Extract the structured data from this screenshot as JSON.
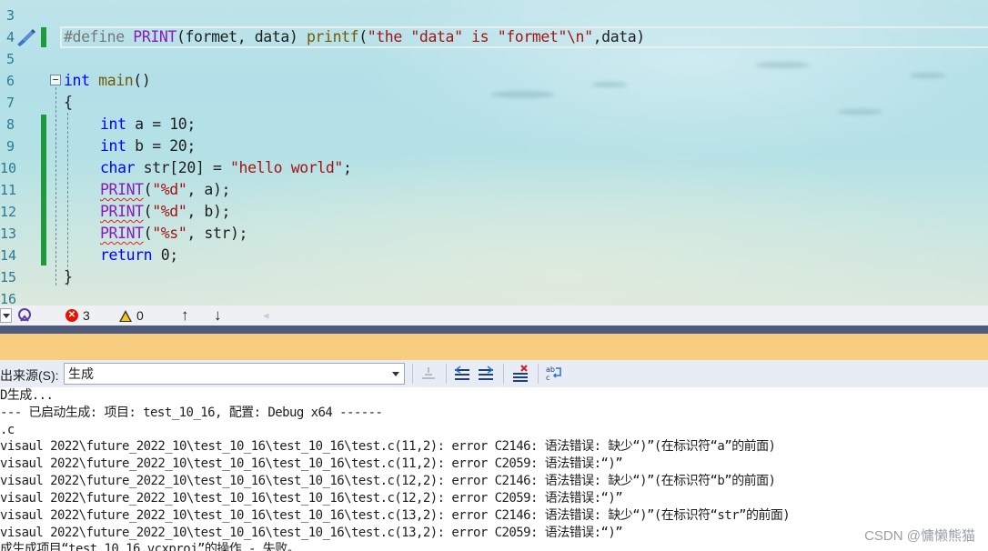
{
  "editor": {
    "line_numbers": [
      "3",
      "4",
      "5",
      "6",
      "7",
      "8",
      "9",
      "10",
      "11",
      "12",
      "13",
      "14",
      "15",
      "16"
    ],
    "code": {
      "l4": {
        "directive": "#define",
        "macro": "PRINT",
        "params": "(formet, data) ",
        "fn": "printf",
        "open": "(",
        "str": "\"the \"data\" is \"formet\"\\n\"",
        "rest": ",data)"
      },
      "l6": {
        "kw": "int",
        "sp": " ",
        "fn": "main",
        "rest": "()"
      },
      "l7": "{",
      "l8": {
        "kw": "int",
        "rest": " a = 10;"
      },
      "l9": {
        "kw": "int",
        "rest": " b = 20;"
      },
      "l10": {
        "kw": "char",
        "mid": " str[20] = ",
        "str": "\"hello world\"",
        "end": ";"
      },
      "l11": {
        "macro": "PRINT",
        "open": "(",
        "str": "\"%d\"",
        "rest": ", a);"
      },
      "l12": {
        "macro": "PRINT",
        "open": "(",
        "str": "\"%d\"",
        "rest": ", b);"
      },
      "l13": {
        "macro": "PRINT",
        "open": "(",
        "str": "\"%s\"",
        "rest": ", str);"
      },
      "l14": {
        "kw": "return",
        "rest": " 0;"
      },
      "l15": "}"
    }
  },
  "status": {
    "error_count": "3",
    "warning_count": "0",
    "up_arrow": "↑",
    "down_arrow": "↓",
    "left_arrow": "◂"
  },
  "output": {
    "source_label": "出来源(S):",
    "source_value": "生成",
    "lines": [
      "D生成...",
      "--- 已启动生成: 项目: test_10_16, 配置: Debug x64 ------",
      ".c",
      "visaul 2022\\future_2022_10\\test_10_16\\test_10_16\\test.c(11,2): error C2146: 语法错误: 缺少“)”(在标识符“a”的前面)",
      "visaul 2022\\future_2022_10\\test_10_16\\test_10_16\\test.c(11,2): error C2059: 语法错误:“)”",
      "visaul 2022\\future_2022_10\\test_10_16\\test_10_16\\test.c(12,2): error C2146: 语法错误: 缺少“)”(在标识符“b”的前面)",
      "visaul 2022\\future_2022_10\\test_10_16\\test_10_16\\test.c(12,2): error C2059: 语法错误:“)”",
      "visaul 2022\\future_2022_10\\test_10_16\\test_10_16\\test.c(13,2): error C2146: 语法错误: 缺少“)”(在标识符“str”的前面)",
      "visaul 2022\\future_2022_10\\test_10_16\\test_10_16\\test.c(13,2): error C2059: 语法错误:“)”",
      "成生成项目“test_10_16.vcxproj”的操作 - 失败。"
    ]
  },
  "watermark": "CSDN @慵懒熊猫"
}
